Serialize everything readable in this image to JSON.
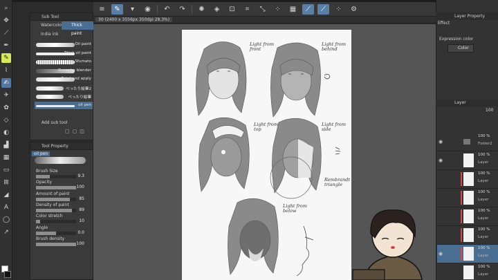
{
  "toolbar": {
    "buttons": [
      "menu-icon",
      "pen-icon",
      "chevron-icon",
      "eye-icon",
      "undo-icon",
      "redo-icon",
      "spinner-icon",
      "fill-icon",
      "transform-icon",
      "crop-icon",
      "deselect-icon",
      "dots-icon",
      "grid-icon",
      "brush-stroke-icon",
      "brush-stroke-icon",
      "dots-icon",
      "settings-icon"
    ]
  },
  "document": {
    "title": "30 (2400 x 3556px 350dpi 28.3%)"
  },
  "subtool": {
    "title": "Sub Tool",
    "tabs": [
      "Watercolor",
      "Thick paint"
    ],
    "extra_tab": "India ink",
    "brushes": [
      "Oil paint",
      "Thick oil paint",
      "Sfumato",
      "Gouache blender",
      "Paint and apply",
      "べったり絵筆2",
      "べったり絵筆",
      "oil pen"
    ],
    "active_brush": "oil pen",
    "add_label": "Add sub tool"
  },
  "toolprop": {
    "title": "Tool Property",
    "current": "oil pen",
    "props": [
      {
        "label": "Brush Size",
        "value": "9.3",
        "level": 0.35
      },
      {
        "label": "Opacity",
        "value": "100",
        "level": 1.0
      },
      {
        "label": "Amount of paint",
        "value": "85",
        "level": 0.85
      },
      {
        "label": "Density of paint",
        "value": "89",
        "level": 0.89
      },
      {
        "label": "Color stretch",
        "value": "10",
        "level": 0.1
      },
      {
        "label": "Angle",
        "value": "0.0",
        "level": 0.5
      },
      {
        "label": "Brush density",
        "value": "100",
        "level": 1.0
      }
    ]
  },
  "right": {
    "layer_property": "Layer Property",
    "effect": "Effect",
    "expression_color": "Expression color",
    "color_select": "Color",
    "layer_title": "Layer",
    "opacity": "100",
    "layers": [
      {
        "pct": "100 %",
        "name": "Folder2",
        "red": false,
        "active": false
      },
      {
        "pct": "100 %",
        "name": "Layer",
        "red": false,
        "active": false
      },
      {
        "pct": "100 %",
        "name": "Layer",
        "red": true,
        "active": false
      },
      {
        "pct": "100 %",
        "name": "Layer",
        "red": true,
        "active": false
      },
      {
        "pct": "100 %",
        "name": "Layer",
        "red": true,
        "active": false
      },
      {
        "pct": "100 %",
        "name": "Layer",
        "red": true,
        "active": false
      },
      {
        "pct": "100 %",
        "name": "Layer",
        "red": true,
        "active": true
      },
      {
        "pct": "100 %",
        "name": "Layer",
        "red": false,
        "active": false
      }
    ]
  },
  "notes": {
    "front": "Light from\nfront",
    "behind": "Light from\nbehind",
    "top": "Light from\ntop",
    "side": "Light from\nside",
    "triangle": "Rembrandt\ntriangle",
    "below": "Light from\nbelow"
  },
  "colors": {
    "accent": "#4a6d92",
    "tool_active": "#d7e85a"
  }
}
